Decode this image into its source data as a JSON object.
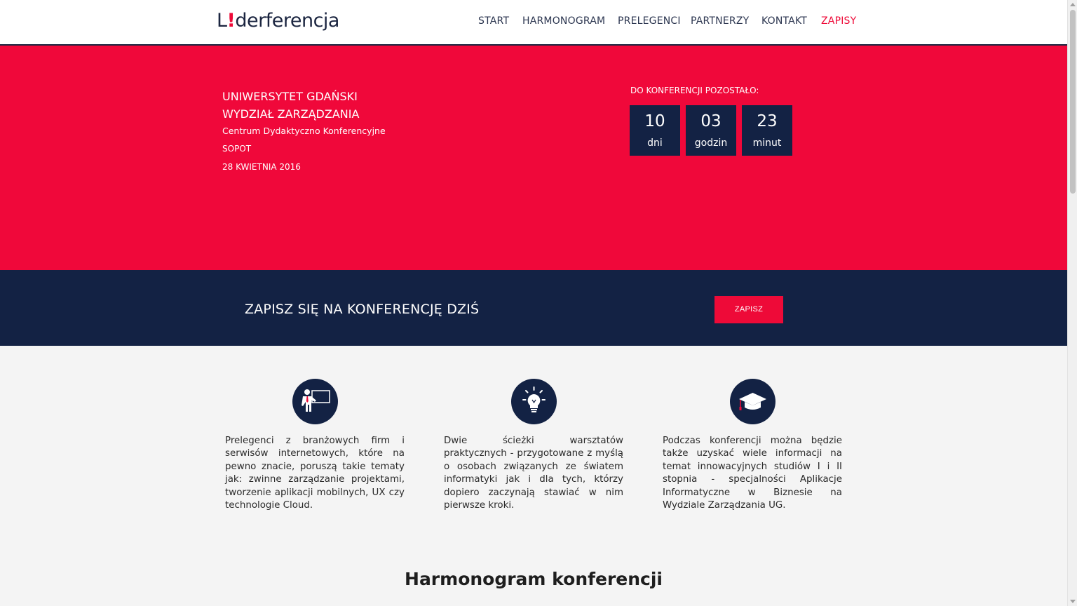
{
  "logo": {
    "pre": "L",
    "excl": "!",
    "post": "derferencja"
  },
  "nav": {
    "items": [
      {
        "label": "START"
      },
      {
        "label": "HARMONOGRAM"
      },
      {
        "label": "PRELEGENCI"
      },
      {
        "label": "PARTNERZY"
      },
      {
        "label": "KONTAKT"
      },
      {
        "label": "ZAPISY",
        "active": true
      }
    ]
  },
  "hero": {
    "university": "UNIWERSYTET GDAŃSKI",
    "faculty": "WYDZIAŁ ZARZĄDZANIA",
    "center": "Centrum Dydaktyczno Konferencyjne",
    "city": "SOPOT",
    "date": "28 KWIETNIA 2016",
    "countdown_label": "DO KONFERENCJI POZOSTAŁO:",
    "countdown": [
      {
        "value": "10",
        "unit": "dni"
      },
      {
        "value": "03",
        "unit": "godzin"
      },
      {
        "value": "23",
        "unit": "minut"
      }
    ]
  },
  "signup": {
    "title": "ZAPISZ SIĘ NA KONFERENCJĘ DZIŚ",
    "button": "ZAPISZ"
  },
  "features": [
    {
      "icon": "presenter-icon",
      "text": "Prelegenci z branżowych firm i serwisów internetowych, które na pewno znacie, poruszą takie tematy jak: zwinne zarządzanie projektami, tworzenie aplikacji mobilnych, UX czy technologie Cloud."
    },
    {
      "icon": "lightbulb-icon",
      "text": "Dwie ścieżki warsztatów praktycznych - przygotowane z myślą o osobach związanych ze światem informatyki jak i dla tych, którzy dopiero zaczynają stawiać w nim pierwsze kroki."
    },
    {
      "icon": "graduation-cap-icon",
      "text": "Podczas konferencji można będzie także uzyskać wiele informacji na temat innowacyjnych studiów I i II stopnia - specjalności Aplikacje Informatyczne w Biznesie na Wydziale Zarządzania UG."
    }
  ],
  "schedule": {
    "title": "Harmonogram konferencji"
  },
  "colors": {
    "accent": "#f0083a",
    "navy": "#132244"
  }
}
